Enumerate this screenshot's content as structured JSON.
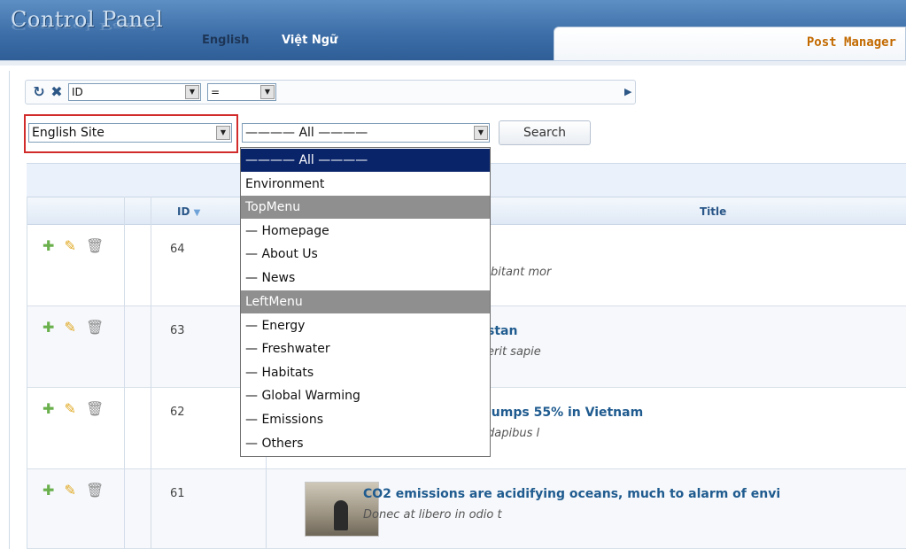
{
  "header": {
    "logo": "Control Panel",
    "lang_english": "English",
    "lang_vietnamese": "Việt Ngữ",
    "active_tab": "Post Manager"
  },
  "toolbar": {
    "field_select": "ID",
    "operator_select": "=",
    "value_input": "",
    "site_select": "English Site",
    "category_select": "———— All ————",
    "search_label": "Search"
  },
  "table": {
    "col_id": "ID",
    "col_title": "Title",
    "rows": [
      {
        "id": "64",
        "title": "",
        "excerpt": "bitant mor"
      },
      {
        "id": "63",
        "title": "stan",
        "excerpt": "erit sapie"
      },
      {
        "id": "62",
        "title": "jumps 55% in Vietnam",
        "excerpt": "dapibus l"
      },
      {
        "id": "61",
        "title": "CO2 emissions are acidifying oceans, much to alarm of envi",
        "excerpt": "Donec at libero in odio t"
      }
    ]
  },
  "dropdown": {
    "items": [
      "———— All ————",
      "Environment",
      "TopMenu",
      "— Homepage",
      "— About Us",
      "— News",
      "LeftMenu",
      "— Energy",
      "— Freshwater",
      "— Habitats",
      "— Global Warming",
      "— Emissions",
      "— Others"
    ]
  },
  "colors": {
    "header_blue": "#3e6fa8",
    "accent_orange": "#c36a00",
    "selected_item": "#0a246a",
    "group_item": "#8f8f8f",
    "highlight_red": "#d22b2b",
    "title_blue": "#1f5b8f"
  }
}
